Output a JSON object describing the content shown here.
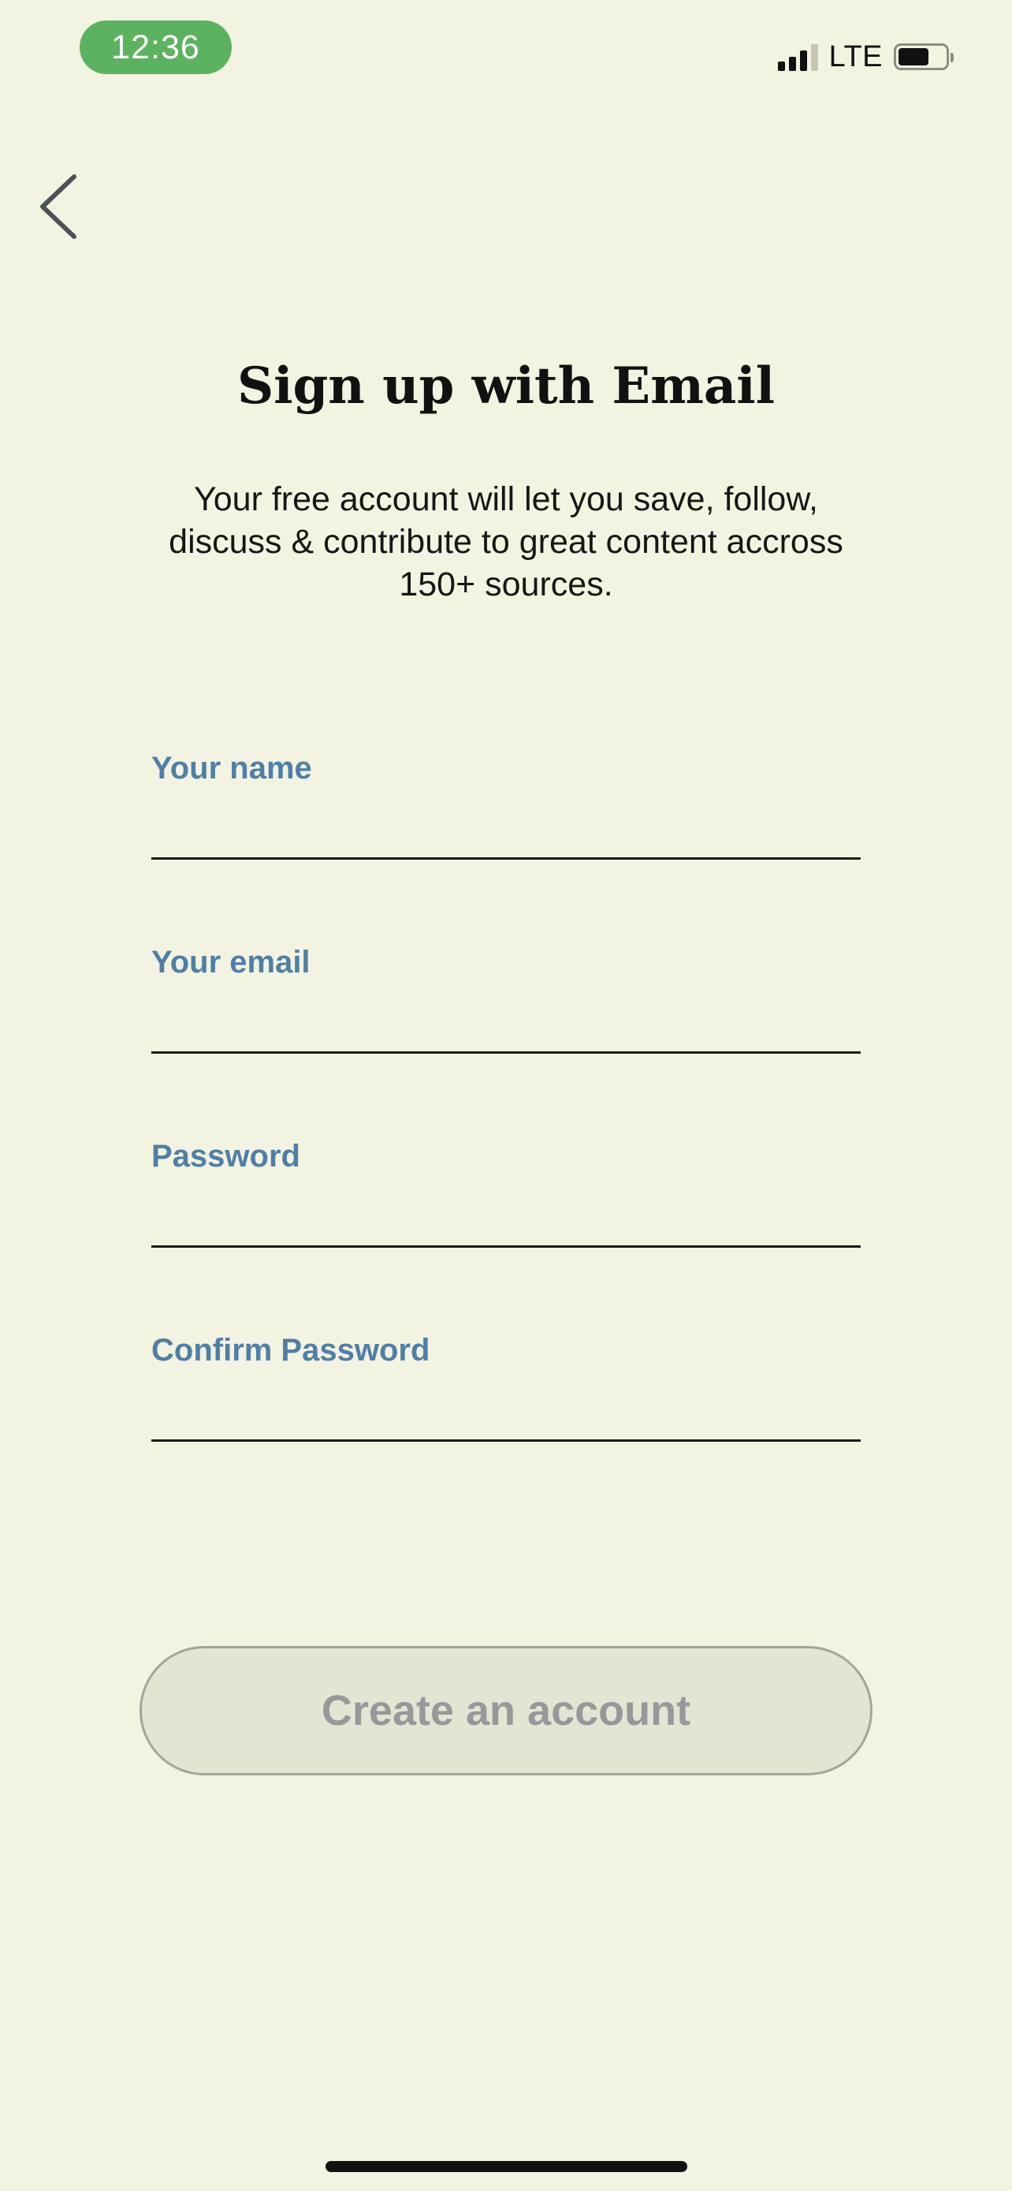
{
  "status_bar": {
    "time": "12:36",
    "network": "LTE"
  },
  "header": {
    "back_icon": "chevron-left-icon"
  },
  "main": {
    "title": "Sign up with Email",
    "subtitle": "Your free account will let you save, follow, discuss & contribute to great content accross 150+ sources."
  },
  "form": {
    "fields": [
      {
        "label": "Your name",
        "value": "",
        "placeholder": ""
      },
      {
        "label": "Your email",
        "value": "",
        "placeholder": ""
      },
      {
        "label": "Password",
        "value": "",
        "placeholder": ""
      },
      {
        "label": "Confirm Password",
        "value": "",
        "placeholder": ""
      }
    ],
    "submit_label": "Create an account"
  },
  "colors": {
    "background": "#f3f3e1",
    "time_pill": "#5cb35f",
    "label": "#4f7fa6",
    "button_bg": "#e4e4d3",
    "button_text": "#98989a"
  }
}
